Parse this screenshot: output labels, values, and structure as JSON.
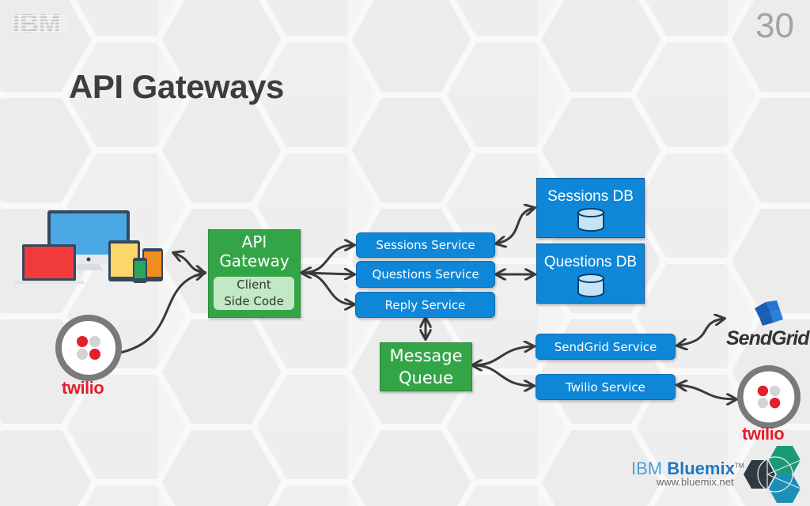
{
  "slide": {
    "brand": "IBM",
    "number": "30",
    "title": "API Gateways"
  },
  "diagram": {
    "clients": {
      "devices_label": "devices-icon",
      "twilio_label": "twilio"
    },
    "gateway": {
      "title_line1": "API",
      "title_line2": "Gateway",
      "inner_line1": "Client",
      "inner_line2": "Side Code"
    },
    "services": [
      {
        "label": "Sessions Service"
      },
      {
        "label": "Questions Service"
      },
      {
        "label": "Reply Service"
      },
      {
        "label": "SendGrid Service"
      },
      {
        "label": "Twilio Service"
      }
    ],
    "databases": [
      {
        "label": "Sessions DB"
      },
      {
        "label": "Questions DB"
      }
    ],
    "queue": {
      "line1": "Message",
      "line2": "Queue"
    },
    "externals": {
      "sendgrid": "SendGrid",
      "twilio": "twilio"
    }
  },
  "footer": {
    "brand_prefix": "IBM ",
    "brand_name": "Bluemix",
    "trademark": "TM",
    "url": "www.bluemix.net"
  },
  "colors": {
    "gateway_green": "#34a546",
    "service_blue": "#0f87d8",
    "twilio_red": "#e31e2d",
    "title_gray": "#3d3d3d"
  }
}
